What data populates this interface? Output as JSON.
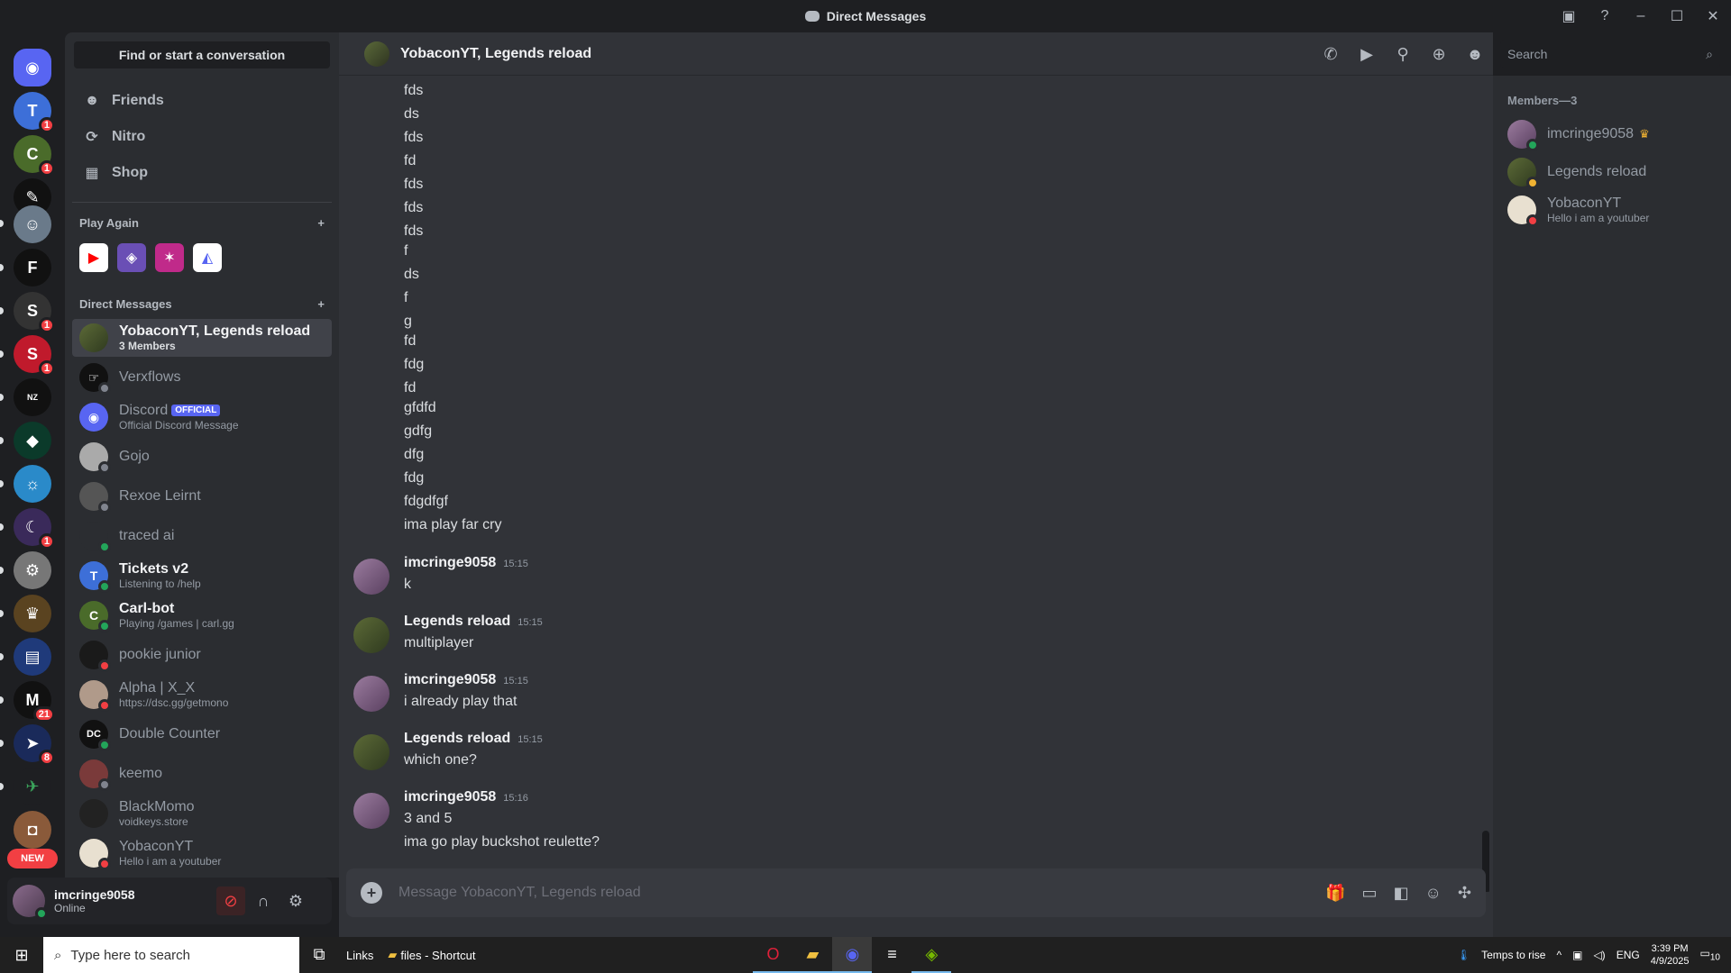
{
  "window": {
    "title": "Direct Messages"
  },
  "dm_sidebar": {
    "find_placeholder": "Find or start a conversation",
    "nav": [
      {
        "label": "Friends",
        "icon": "friends-icon"
      },
      {
        "label": "Nitro",
        "icon": "nitro-icon"
      },
      {
        "label": "Shop",
        "icon": "shop-icon"
      }
    ],
    "play_again_label": "Play Again",
    "direct_messages_label": "Direct Messages",
    "dms": [
      {
        "name": "YobaconYT, Legends reload",
        "sub": "3 Members",
        "status": "none",
        "active": true,
        "strong": true
      },
      {
        "name": "Verxflows",
        "sub": "",
        "status": "offline"
      },
      {
        "name": "Discord",
        "sub": "Official Discord Message",
        "status": "none",
        "tag": "OFFICIAL"
      },
      {
        "name": "Gojo",
        "sub": "",
        "status": "offline"
      },
      {
        "name": "Rexoe Leirnt",
        "sub": "",
        "status": "offline"
      },
      {
        "name": "traced ai",
        "sub": "",
        "status": "online"
      },
      {
        "name": "Tickets v2",
        "sub": "Listening to /help",
        "status": "online",
        "strong": true
      },
      {
        "name": "Carl-bot",
        "sub": "Playing /games | carl.gg",
        "status": "online",
        "strong": true
      },
      {
        "name": "pookie junior",
        "sub": "",
        "status": "dnd"
      },
      {
        "name": "Alpha | X_X",
        "sub": "https://dsc.gg/getmono",
        "status": "dnd"
      },
      {
        "name": "Double Counter",
        "sub": "",
        "status": "online"
      },
      {
        "name": "keemo",
        "sub": "",
        "status": "offline"
      },
      {
        "name": "BlackMomo",
        "sub": "voidkeys.store",
        "status": "none"
      },
      {
        "name": "YobaconYT",
        "sub": "Hello i am a youtuber",
        "status": "dnd"
      }
    ]
  },
  "user_panel": {
    "name": "imcringe9058",
    "status": "Online"
  },
  "rail": {
    "new_label": "NEW",
    "badges": [
      "1",
      "1",
      "1",
      "1",
      "1",
      "21",
      "8"
    ]
  },
  "chat": {
    "header_title": "YobaconYT, Legends reload",
    "lines": [
      "fds",
      "ds",
      "fds",
      "fd",
      "fds",
      "fds",
      "fds",
      "f",
      "ds",
      "f",
      "g",
      "fd",
      "fdg",
      "fd",
      "gfdfd",
      "gdfg",
      "dfg",
      "fdg",
      "fdgdfgf",
      "ima play far cry"
    ],
    "groups": [
      {
        "author": "imcringe9058",
        "time": "15:15",
        "messages": [
          "k"
        ],
        "avatar": "purple"
      },
      {
        "author": "Legends reload",
        "time": "15:15",
        "messages": [
          "multiplayer"
        ],
        "avatar": "green"
      },
      {
        "author": "imcringe9058",
        "time": "15:15",
        "messages": [
          "i already play that"
        ],
        "avatar": "purple"
      },
      {
        "author": "Legends reload",
        "time": "15:15",
        "messages": [
          "which one?"
        ],
        "avatar": "green"
      },
      {
        "author": "imcringe9058",
        "time": "15:16",
        "messages": [
          "3 and 5",
          "ima go play buckshot reulette?"
        ],
        "avatar": "purple"
      }
    ],
    "composer_placeholder": "Message YobaconYT, Legends reload"
  },
  "search": {
    "placeholder": "Search"
  },
  "members": {
    "header": "Members—3",
    "list": [
      {
        "name": "imcringe9058",
        "sub": "",
        "status": "online",
        "owner": true
      },
      {
        "name": "Legends reload",
        "sub": "",
        "status": "idle"
      },
      {
        "name": "YobaconYT",
        "sub": "Hello i am a youtuber",
        "status": "dnd"
      }
    ]
  },
  "taskbar": {
    "search_placeholder": "Type here to search",
    "links_label": "Links",
    "shortcut_label": "files - Shortcut",
    "weather": "Temps to rise",
    "language": "ENG",
    "time": "3:39 PM",
    "date": "4/9/2025",
    "notif_count": "10"
  }
}
